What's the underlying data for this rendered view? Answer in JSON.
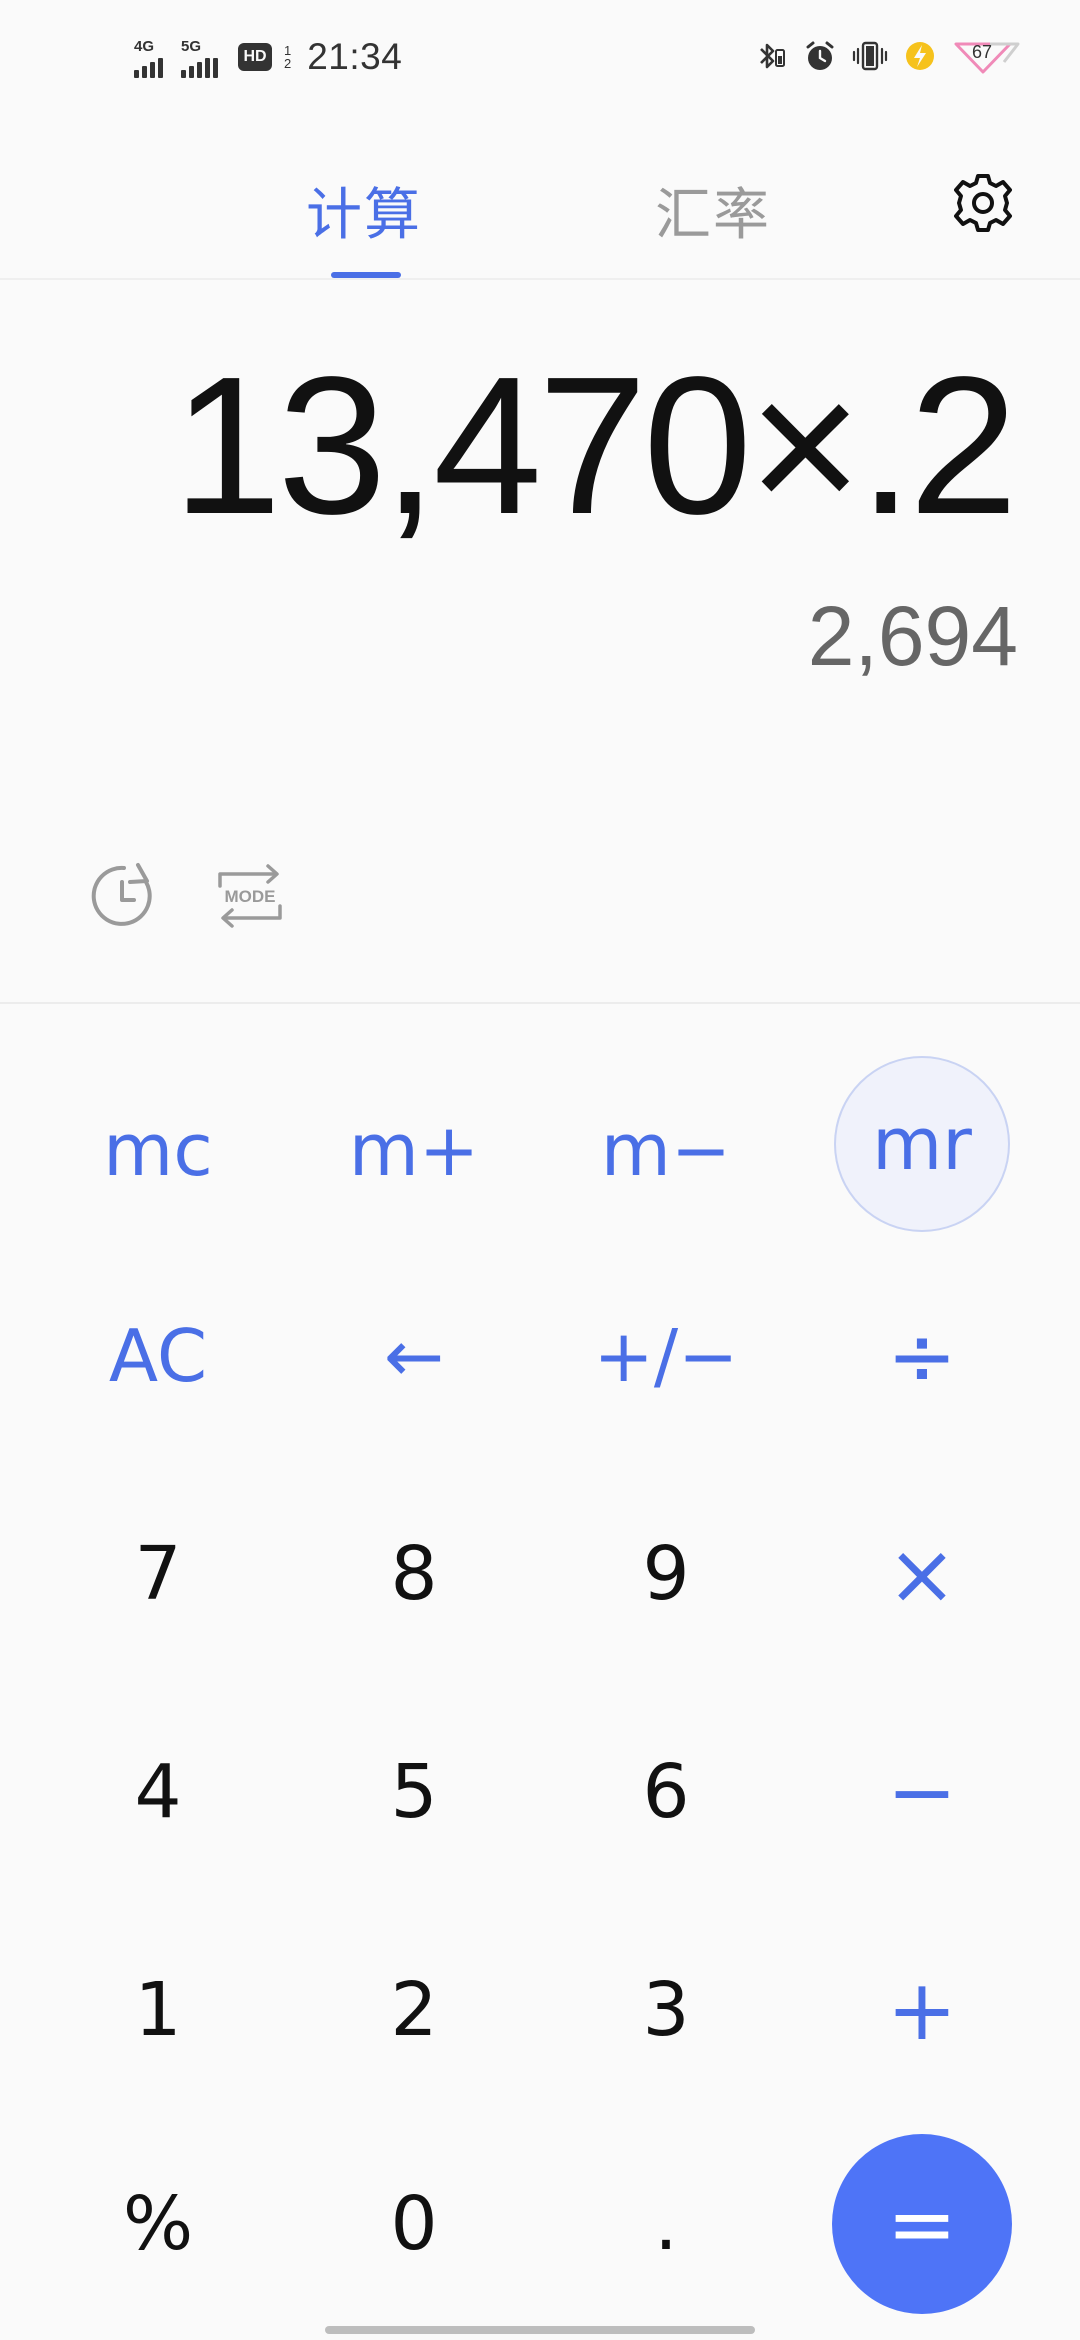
{
  "status_bar": {
    "time": "21:34",
    "sim1_label": "4G",
    "sim2_label": "5G",
    "hd_label": "HD",
    "hd_sub_top": "1",
    "hd_sub_bottom": "2",
    "battery_level": "67"
  },
  "tabs": [
    {
      "label": "计算",
      "active": true
    },
    {
      "label": "汇率",
      "active": false
    }
  ],
  "display": {
    "expression": "13,470×.2",
    "result": "2,694"
  },
  "icons": {
    "settings": "gear-icon",
    "history": "history-clock-icon",
    "mode": "mode-switch-icon"
  },
  "mode_label": "MODE",
  "keypad": {
    "memory": [
      "mc",
      "m+",
      "m−",
      "mr"
    ],
    "functions": [
      "AC",
      "←",
      "+/−",
      "÷"
    ],
    "row7": [
      "7",
      "8",
      "9",
      "×"
    ],
    "row4": [
      "4",
      "5",
      "6",
      "−"
    ],
    "row1": [
      "1",
      "2",
      "3",
      "+"
    ],
    "row0": [
      "%",
      "0",
      ".",
      "="
    ]
  },
  "colors": {
    "accent": "#4a6fe6",
    "equals_bg": "#4e74f7",
    "background": "#fafafa",
    "inactive_tab": "#9a9a9a",
    "result_text": "#666666"
  }
}
